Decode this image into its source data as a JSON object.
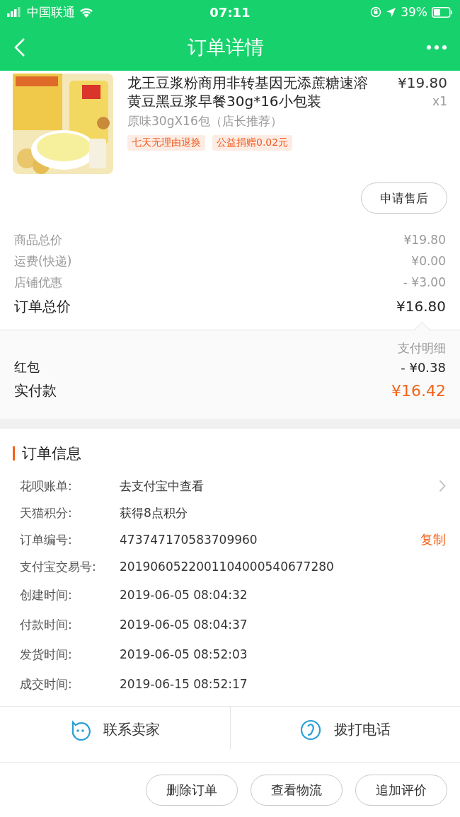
{
  "status_bar": {
    "carrier": "中国联通",
    "time": "07:11",
    "battery": "39%"
  },
  "header": {
    "title": "订单详情"
  },
  "product": {
    "title": "龙王豆浆粉商用非转基因无添蔗糖速溶黄豆黑豆浆早餐30g*16小包装",
    "price": "¥19.80",
    "quantity": "x1",
    "spec": "原味30gX16包（店长推荐）",
    "tags": [
      "七天无理由退换",
      "公益捐赠0.02元"
    ],
    "action": "申请售后"
  },
  "price_rows": [
    {
      "kind": "minor",
      "label": "商品总价",
      "value": "¥19.80"
    },
    {
      "kind": "minor",
      "label": "运费(快递)",
      "value": "¥0.00"
    },
    {
      "kind": "minor",
      "label": "店铺优惠",
      "value": "- ¥3.00"
    },
    {
      "kind": "total",
      "label": "订单总价",
      "value": "¥16.80"
    }
  ],
  "payment": {
    "detail_link": "支付明细",
    "rows": [
      {
        "kind": "normal",
        "label": "红包",
        "value": "- ¥0.38"
      },
      {
        "kind": "paid",
        "label": "实付款",
        "value": "¥16.42"
      }
    ]
  },
  "order_info": {
    "title": "订单信息",
    "rows": [
      {
        "label": "花呗账单:",
        "value": "去支付宝中查看",
        "chevron": true
      },
      {
        "label": "天猫积分:",
        "value": "获得8点积分",
        "chevron": false
      },
      {
        "label": "订单编号:",
        "value": "473747170583709960",
        "action": "复制",
        "chevron": false
      },
      {
        "label": "支付宝交易号:",
        "value": "2019060522001104000540677280",
        "chevron": false
      },
      {
        "label": "创建时间:",
        "value": "2019-06-05 08:04:32",
        "chevron": false
      },
      {
        "label": "付款时间:",
        "value": "2019-06-05 08:04:37",
        "chevron": false
      },
      {
        "label": "发货时间:",
        "value": "2019-06-05 08:52:03",
        "chevron": false
      },
      {
        "label": "成交时间:",
        "value": "2019-06-15 08:52:17",
        "chevron": false
      }
    ]
  },
  "contacts": [
    {
      "kind": "chat",
      "label": "联系卖家"
    },
    {
      "kind": "phone",
      "label": "拨打电话"
    }
  ],
  "footer_buttons": [
    "删除订单",
    "查看物流",
    "追加评价"
  ]
}
